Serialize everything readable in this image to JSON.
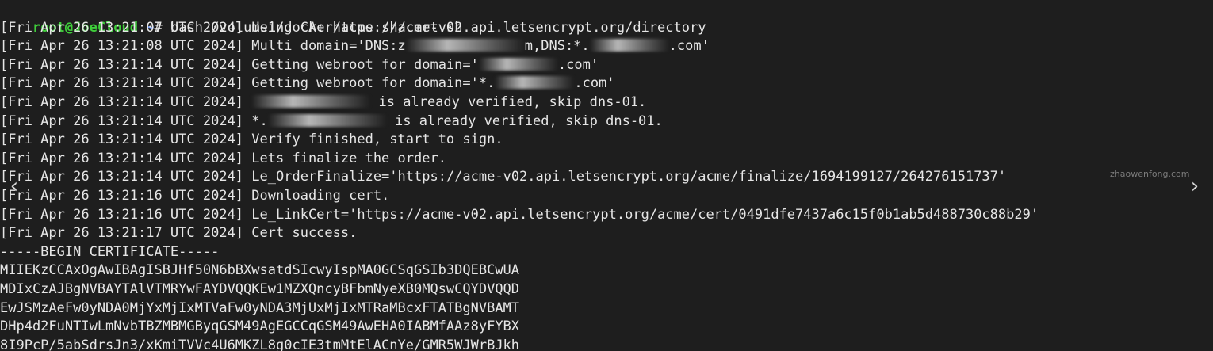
{
  "prompt": {
    "user_host": "root@JoeCloud",
    "separator": ":",
    "path": "~",
    "symbol": "#",
    "command": "bash /volume1/docker/acme.sh/cert.sh"
  },
  "log": [
    {
      "ts": "[Fri Apr 26 13:21:07 UTC 2024]",
      "pre": "Using CA: https://acme-v02.api.letsencrypt.org/directory",
      "redact": "",
      "post": ""
    },
    {
      "ts": "[Fri Apr 26 13:21:08 UTC 2024]",
      "pre": "Multi domain='DNS:z",
      "redact": "long",
      "post": "m,DNS:*.",
      "redact2": "med",
      "post2": ".com'"
    },
    {
      "ts": "[Fri Apr 26 13:21:14 UTC 2024]",
      "pre": "Getting webroot for domain='",
      "redact": "med",
      "post": ".com'"
    },
    {
      "ts": "[Fri Apr 26 13:21:14 UTC 2024]",
      "pre": "Getting webroot for domain='*.",
      "redact": "med",
      "post": ".com'"
    },
    {
      "ts": "[Fri Apr 26 13:21:14 UTC 2024]",
      "pre": "",
      "redact": "long",
      "post": " is already verified, skip dns-01."
    },
    {
      "ts": "[Fri Apr 26 13:21:14 UTC 2024]",
      "pre": "*.",
      "redact": "long",
      "post": " is already verified, skip dns-01."
    },
    {
      "ts": "[Fri Apr 26 13:21:14 UTC 2024]",
      "pre": "Verify finished, start to sign.",
      "redact": "",
      "post": ""
    },
    {
      "ts": "[Fri Apr 26 13:21:14 UTC 2024]",
      "pre": "Lets finalize the order.",
      "redact": "",
      "post": ""
    },
    {
      "ts": "[Fri Apr 26 13:21:14 UTC 2024]",
      "pre": "Le_OrderFinalize='https://acme-v02.api.letsencrypt.org/acme/finalize/1694199127/264276151737'",
      "redact": "",
      "post": ""
    },
    {
      "ts": "[Fri Apr 26 13:21:16 UTC 2024]",
      "pre": "Downloading cert.",
      "redact": "",
      "post": ""
    },
    {
      "ts": "[Fri Apr 26 13:21:16 UTC 2024]",
      "pre": "Le_LinkCert='https://acme-v02.api.letsencrypt.org/acme/cert/0491dfe7437a6c15f0b1ab5d488730c88b29'",
      "redact": "",
      "post": ""
    },
    {
      "ts": "[Fri Apr 26 13:21:17 UTC 2024]",
      "pre": "Cert success.",
      "redact": "",
      "post": ""
    }
  ],
  "certificate": [
    "-----BEGIN CERTIFICATE-----",
    "MIIEKzCCAxOgAwIBAgISBJHf50N6bBXwsatdSIcwyIspMA0GCSqGSIb3DQEBCwUA",
    "MDIxCzAJBgNVBAYTAlVTMRYwFAYDVQQKEw1MZXQncyBFbmNyeXB0MQswCQYDVQQD",
    "EwJSMzAeFw0yNDA0MjYxMjIxMTVaFw0yNDA3MjUxMjIxMTRaMBcxFTATBgNVBAMT",
    "DHp4d2FuNTIwLmNvbTBZMBMGByqGSM49AgEGCCqGSM49AwEHA0IABMfAAz8yFYBX",
    "8I9PcP/5abSdrsJn3/xKmiTVVc4U6MKZL8g0cIE3tmMtElACnYe/GMR5WJWrBJkh"
  ],
  "watermark": "zhaowenfong.com",
  "nav": {
    "prev": "‹",
    "next": "›"
  }
}
